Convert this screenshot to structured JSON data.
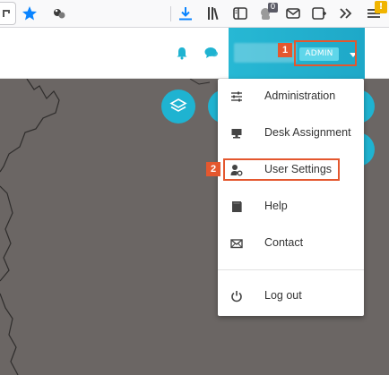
{
  "toolbar": {
    "container_badge": "0",
    "warning_badge": "!",
    "icons": [
      "partial-urlbar",
      "bookmark-star-icon",
      "extension-icon",
      "download-icon",
      "library-icon",
      "sidebar-icon",
      "extension-badge-icon",
      "mail-icon",
      "new-window-icon",
      "overflow-icon",
      "menu-icon"
    ]
  },
  "header": {
    "notification_icon": "bell-icon",
    "chat_icon": "chat-icon",
    "role_badge": "ADMIN",
    "menu_caret": "caret-down-icon",
    "accent_color": "#1fb3d1"
  },
  "dropdown": {
    "items": [
      {
        "label": "Administration",
        "icon": "sliders-icon"
      },
      {
        "label": "Desk Assignment",
        "icon": "desk-icon"
      },
      {
        "label": "User Settings",
        "icon": "user-settings-icon"
      },
      {
        "label": "Help",
        "icon": "book-icon"
      },
      {
        "label": "Contact",
        "icon": "envelope-icon"
      },
      {
        "label": "Log out",
        "icon": "power-icon"
      }
    ]
  },
  "annotations": {
    "step1": "1",
    "step2": "2",
    "color": "#e4572e"
  }
}
